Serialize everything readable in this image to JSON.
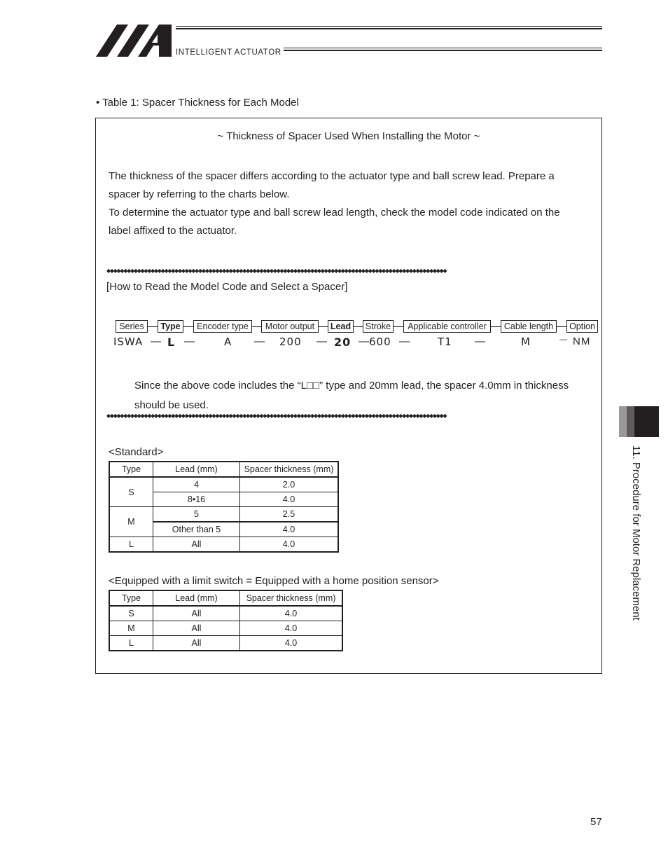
{
  "header": {
    "logo": "iai-logo",
    "brand_name": "INTELLIGENT ACTUATOR"
  },
  "caption": "• Table 1: Spacer Thickness for Each Model",
  "frame": {
    "title": "~ Thickness of Spacer Used When Installing the Motor ~",
    "intro_lines": [
      "The thickness of the spacer differs according to the actuator type and ball screw lead. Prepare a",
      "spacer by referring to the charts below.",
      "To determine the actuator type and ball screw lead length, check the model code indicated on the",
      "label affixed to the actuator."
    ],
    "dot_separator": "◆◆◆◆◆◆◆◆◆◆◆◆◆◆◆◆◆◆◆◆◆◆◆◆◆◆◆◆◆◆◆◆◆◆◆◆◆◆◆◆◆◆◆◆◆◆◆◆◆◆◆◆◆◆◆◆◆◆◆◆◆◆◆◆◆◆◆◆◆◆◆◆◆◆◆◆◆◆◆◆◆◆◆◆◆◆◆◆◆◆◆◆◆◆◆◆◆◆◆◆",
    "howto_title": "[How to Read the Model Code and Select a Spacer]",
    "model_code": {
      "fields": [
        {
          "label": "Series",
          "value": "ISWA",
          "bold": false
        },
        {
          "label": "Type",
          "value": "L",
          "bold": true
        },
        {
          "label": "Encoder type",
          "value": "A",
          "bold": false
        },
        {
          "label": "Motor output",
          "value": "200",
          "bold": false
        },
        {
          "label": "Lead",
          "value": "20",
          "bold": true
        },
        {
          "label": "Stroke",
          "value": "600",
          "bold": false
        },
        {
          "label": "Applicable controller",
          "value": "T1",
          "bold": false
        },
        {
          "label": "Cable length",
          "value": "M",
          "bold": false
        },
        {
          "label": "Option",
          "value": "NM",
          "bold": false
        }
      ],
      "separator": "—"
    },
    "conclusion_lines": [
      "Since the above code includes the “L□□” type and 20mm lead, the spacer 4.0mm in thickness",
      "should be used."
    ],
    "standard": {
      "title": "<Standard>",
      "headers": [
        "Type",
        "Lead (mm)",
        "Spacer thickness (mm)"
      ],
      "groups": [
        {
          "type": "S",
          "rows": [
            {
              "lead": "4",
              "thickness": "2.0"
            },
            {
              "lead": "8•16",
              "thickness": "4.0"
            }
          ]
        },
        {
          "type": "M",
          "rows": [
            {
              "lead": "5",
              "thickness": "2.5"
            },
            {
              "lead": "Other than 5",
              "thickness": "4.0"
            }
          ]
        },
        {
          "type": "L",
          "rows": [
            {
              "lead": "All",
              "thickness": "4.0"
            }
          ]
        }
      ]
    },
    "limit_switch": {
      "title": "<Equipped with a limit switch = Equipped with a home position sensor>",
      "headers": [
        "Type",
        "Lead (mm)",
        "Spacer thickness (mm)"
      ],
      "rows": [
        {
          "type": "S",
          "lead": "All",
          "thickness": "4.0"
        },
        {
          "type": "M",
          "lead": "All",
          "thickness": "4.0"
        },
        {
          "type": "L",
          "lead": "All",
          "thickness": "4.0"
        }
      ]
    }
  },
  "side_tab": {
    "label": "11. Procedure for Motor Replacement",
    "colors": [
      "#9a9899",
      "#5e5c5d",
      "#231f20"
    ]
  },
  "page_number": "57"
}
